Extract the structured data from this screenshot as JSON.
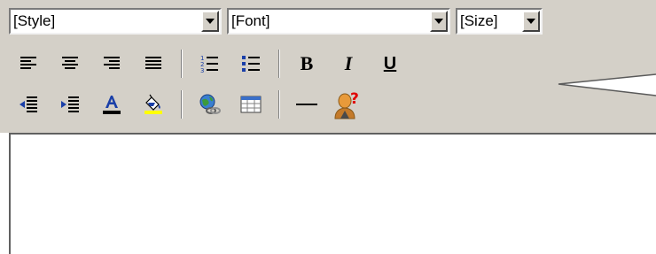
{
  "editor": {
    "style_select": {
      "value": "[Style]"
    },
    "font_select": {
      "value": "[Font]"
    },
    "size_select": {
      "value": "[Size]"
    },
    "formatting": {
      "bold_label": "B",
      "italic_label": "I",
      "underline_label": "U"
    },
    "content_area": {
      "text": ""
    }
  },
  "colors": {
    "toolbar_bg": "#d4d0c8",
    "text_color_bar": "#000000",
    "highlight_bar": "#ffff00",
    "help_accent": "#e00000"
  },
  "icons": [
    "align-left-icon",
    "align-center-icon",
    "align-right-icon",
    "justify-icon",
    "ordered-list-icon",
    "unordered-list-icon",
    "outdent-icon",
    "indent-icon",
    "font-color-icon",
    "highlight-color-icon",
    "insert-link-icon",
    "insert-table-icon",
    "horizontal-rule-icon",
    "help-icon"
  ]
}
